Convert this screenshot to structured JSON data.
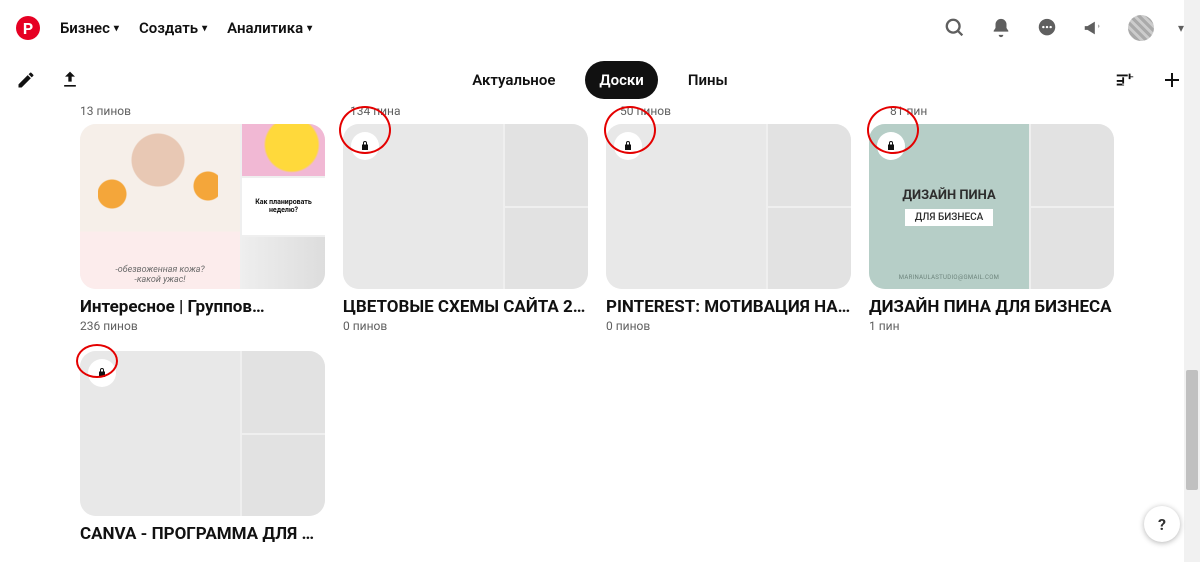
{
  "nav": {
    "business": "Бизнес",
    "create": "Создать",
    "analytics": "Аналитика"
  },
  "tabs": {
    "featured": "Актуальное",
    "boards": "Доски",
    "pins": "Пины"
  },
  "top_counts": [
    "13 пинов",
    "134 пина",
    "50 пинов",
    "81 пин"
  ],
  "boards": [
    {
      "title": "Интересное | Группов…",
      "count": "236 пинов",
      "locked": false,
      "overlay1": "-обезвоженная кожа?",
      "overlay2": "-какой ужас!",
      "side_text": "Как планировать неделю?"
    },
    {
      "title": "ЦВЕТОВЫЕ СХЕМЫ САЙТА 2…",
      "count": "0 пинов",
      "locked": true
    },
    {
      "title": "PINTEREST: МОТИВАЦИЯ НА…",
      "count": "0 пинов",
      "locked": true
    },
    {
      "title": "ДИЗАЙН ПИНА ДЛЯ БИЗНЕСА",
      "count": "1 пин",
      "locked": true,
      "dp_title": "ДИЗАЙН ПИНА",
      "dp_sub": "ДЛЯ БИЗНЕСА",
      "dp_mail": "MARINAULASTUDIO@GMAIL.COM"
    },
    {
      "title": "CANVA - ПРОГРАММА ДЛЯ С…",
      "count": "",
      "locked": true
    }
  ],
  "help": "?"
}
